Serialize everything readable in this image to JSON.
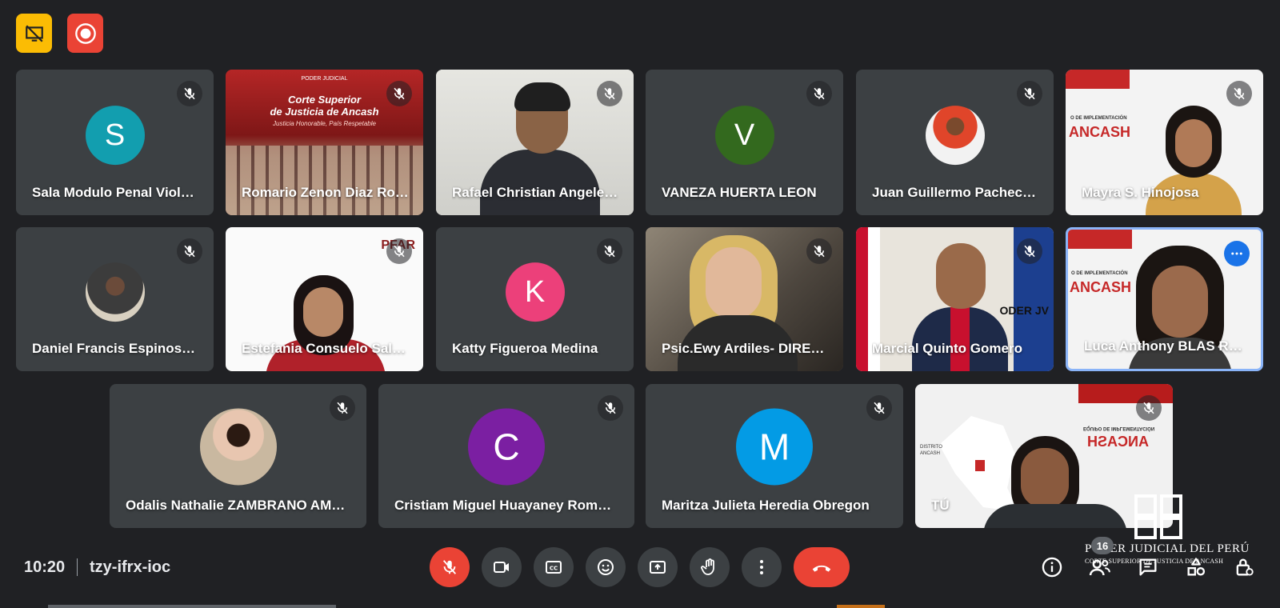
{
  "meeting": {
    "time": "10:20",
    "code": "tzy-ifrx-ioc"
  },
  "participant_count": "16",
  "colors": {
    "background": "#202124",
    "tile": "#3c4043",
    "hangup": "#ea4335",
    "active_border": "#8ab4f8",
    "top_yellow": "#fbbc04",
    "top_red": "#ea4335"
  },
  "tiles": [
    {
      "name": "Sala Modulo Penal Viol…",
      "type": "initial",
      "initial": "S",
      "avatar_color": "#129eaf"
    },
    {
      "name": "Romario Zenon Diaz Ro…",
      "type": "banner",
      "banner_title": "Corte Superior\nde Justicia de Ancash",
      "banner_sub": "Justicia Honorable, País Respetable",
      "banner_logo": "PODER JUDICIAL"
    },
    {
      "name": "Rafael Christian Angele…",
      "type": "video"
    },
    {
      "name": "VANEZA HUERTA LEON",
      "type": "initial",
      "initial": "V",
      "avatar_color": "#33691e"
    },
    {
      "name": "Juan Guillermo Pachec…",
      "type": "photo"
    },
    {
      "name": "Mayra S. Hinojosa",
      "type": "video",
      "slide_text": "ANCASH",
      "slide_sub": "O DE IMPLEMENTACIÓN"
    },
    {
      "name": "Daniel Francis Espinos…",
      "type": "photo"
    },
    {
      "name": "Estefania Consuelo Sal…",
      "type": "video",
      "slide_text": "PFAR"
    },
    {
      "name": "Katty Figueroa Medina",
      "type": "initial",
      "initial": "K",
      "avatar_color": "#ec407a"
    },
    {
      "name": "Psic.Ewy Ardiles- DIRE…",
      "type": "video"
    },
    {
      "name": "Marcial Quinto Gomero",
      "type": "video",
      "slide_text": "ODER JV"
    },
    {
      "name": "Luca Anthony BLAS RO…",
      "type": "video",
      "slide_text": "ANCASH",
      "slide_sub": "O DE IMPLEMENTACIÓN"
    },
    {
      "name": "Odalis Nathalie ZAMBRANO AM…",
      "type": "photo"
    },
    {
      "name": "Cristiam Miguel Huayaney Rom…",
      "type": "initial",
      "initial": "C",
      "avatar_color": "#7b1fa2"
    },
    {
      "name": "Maritza Julieta Heredia Obregon",
      "type": "initial",
      "initial": "M",
      "avatar_color": "#039be5"
    },
    {
      "name": "TÚ",
      "type": "self",
      "slide_text": "ANCASH",
      "slide_sub": "EQUIPO DE IMPLEMENTACIÓN",
      "map_label": "DISTRITO ANCASH"
    }
  ],
  "watermark": {
    "line1": "PODER JUDICIAL DEL PERÚ",
    "line2": "CORTE SUPERIOR DE JUSTICIA DE ANCASH"
  },
  "icons": {
    "top_left_1": "no-presentation-icon",
    "top_left_2": "record-icon",
    "controls": [
      "mic-off-icon",
      "camera-icon",
      "captions-icon",
      "emoji-icon",
      "present-screen-icon",
      "raise-hand-icon",
      "more-options-icon",
      "hang-up-icon"
    ],
    "right": [
      "info-icon",
      "people-icon",
      "chat-icon",
      "activities-icon",
      "host-controls-icon"
    ]
  }
}
